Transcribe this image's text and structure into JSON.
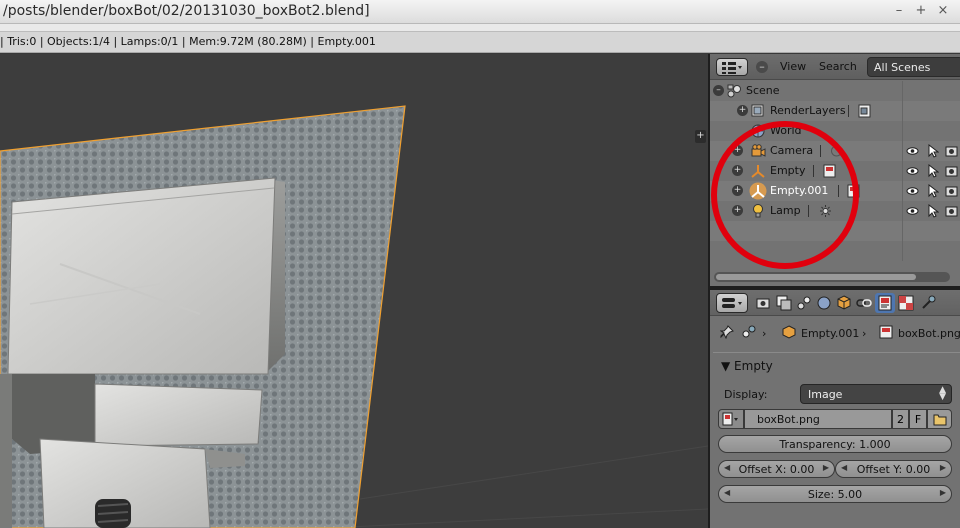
{
  "window": {
    "title": "/posts/blender/boxBot/02/20131030_boxBot2.blend]",
    "controls": [
      "–",
      "+",
      "×"
    ]
  },
  "info_bar": {
    "stats": "| Tris:0 | Objects:1/4 | Lamps:0/1 | Mem:9.72M (80.28M) | Empty.001"
  },
  "viewport": {
    "plus_button": "+"
  },
  "outliner": {
    "header": {
      "minus": "–",
      "view_menu": "View",
      "search_menu": "Search",
      "display_mode": "All Scenes"
    },
    "rows": [
      {
        "label": "Scene",
        "expander": "–"
      },
      {
        "label": "RenderLayers",
        "expander": "+"
      },
      {
        "label": "World"
      },
      {
        "label": "Camera",
        "expander": "+"
      },
      {
        "label": "Empty",
        "expander": "+"
      },
      {
        "label": "Empty.001",
        "expander": "+"
      },
      {
        "label": "Lamp",
        "expander": "+"
      }
    ],
    "annotation_color": "#e0000d"
  },
  "properties": {
    "breadcrumb": {
      "object": "Empty.001",
      "data": "boxBot.png"
    },
    "panel": {
      "title": "Empty",
      "display_label": "Display:",
      "display_value": "Image",
      "image_name": "boxBot.png",
      "image_users": "2",
      "fake_user": "F",
      "transparency": "Transparency: 1.000",
      "offset_x": "Offset X: 0.00",
      "offset_y": "Offset Y: 0.00",
      "size": "Size: 5.00"
    },
    "active_tab_color": "#4e76b0"
  }
}
